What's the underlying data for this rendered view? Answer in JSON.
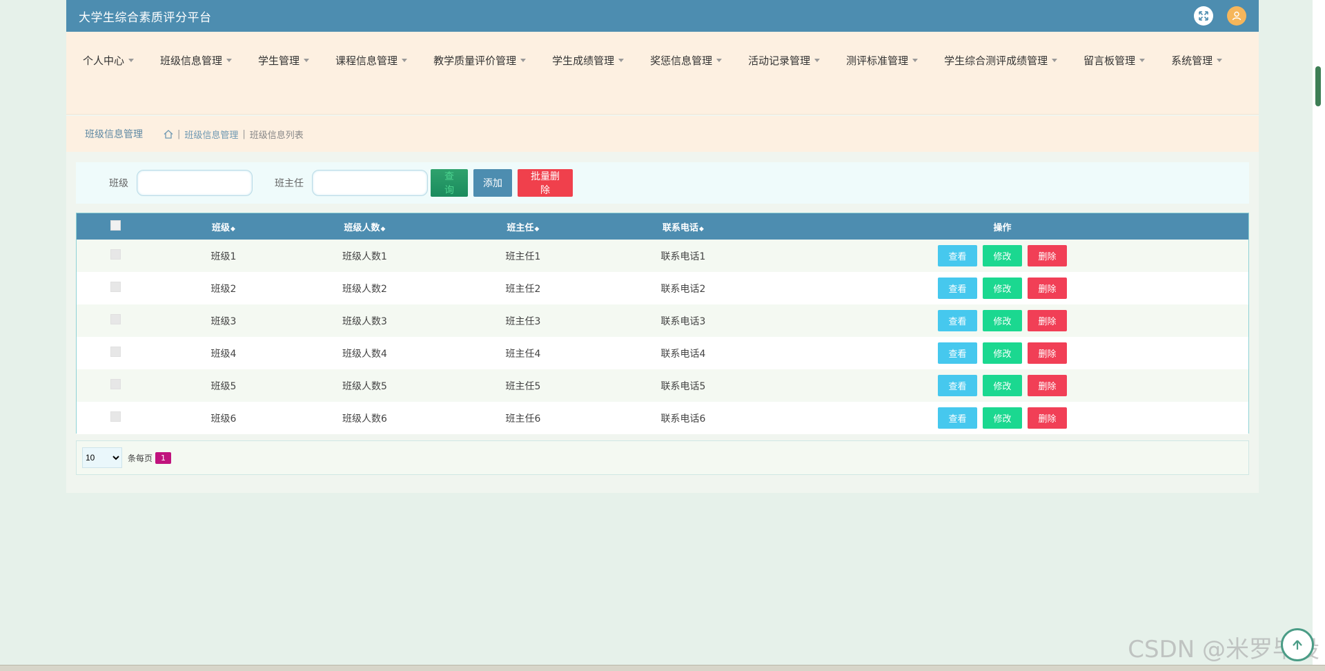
{
  "app": {
    "title": "大学生综合素质评分平台"
  },
  "menu": [
    {
      "label": "个人中心"
    },
    {
      "label": "班级信息管理"
    },
    {
      "label": "学生管理"
    },
    {
      "label": "课程信息管理"
    },
    {
      "label": "教学质量评价管理"
    },
    {
      "label": "学生成绩管理"
    },
    {
      "label": "奖惩信息管理"
    },
    {
      "label": "活动记录管理"
    },
    {
      "label": "测评标准管理"
    },
    {
      "label": "学生综合测评成绩管理"
    },
    {
      "label": "留言板管理"
    },
    {
      "label": "系统管理"
    }
  ],
  "breadcrumb": {
    "title": "班级信息管理",
    "items": [
      "班级信息管理",
      "班级信息列表"
    ]
  },
  "search": {
    "class_label": "班级",
    "teacher_label": "班主任",
    "search_label": "查询",
    "add_label": "添加",
    "batch_delete_label": "批量删除"
  },
  "table": {
    "headers": [
      "班级",
      "班级人数",
      "班主任",
      "联系电话",
      "操作"
    ],
    "rows": [
      {
        "class": "班级1",
        "count": "班级人数1",
        "teacher": "班主任1",
        "phone": "联系电话1"
      },
      {
        "class": "班级2",
        "count": "班级人数2",
        "teacher": "班主任2",
        "phone": "联系电话2"
      },
      {
        "class": "班级3",
        "count": "班级人数3",
        "teacher": "班主任3",
        "phone": "联系电话3"
      },
      {
        "class": "班级4",
        "count": "班级人数4",
        "teacher": "班主任4",
        "phone": "联系电话4"
      },
      {
        "class": "班级5",
        "count": "班级人数5",
        "teacher": "班主任5",
        "phone": "联系电话5"
      },
      {
        "class": "班级6",
        "count": "班级人数6",
        "teacher": "班主任6",
        "phone": "联系电话6"
      }
    ],
    "actions": {
      "view": "查看",
      "edit": "修改",
      "delete": "删除"
    }
  },
  "pager": {
    "page_size": "10",
    "per_page_label": "条每页",
    "current_page": "1"
  },
  "watermark": "CSDN @米罗毕设"
}
